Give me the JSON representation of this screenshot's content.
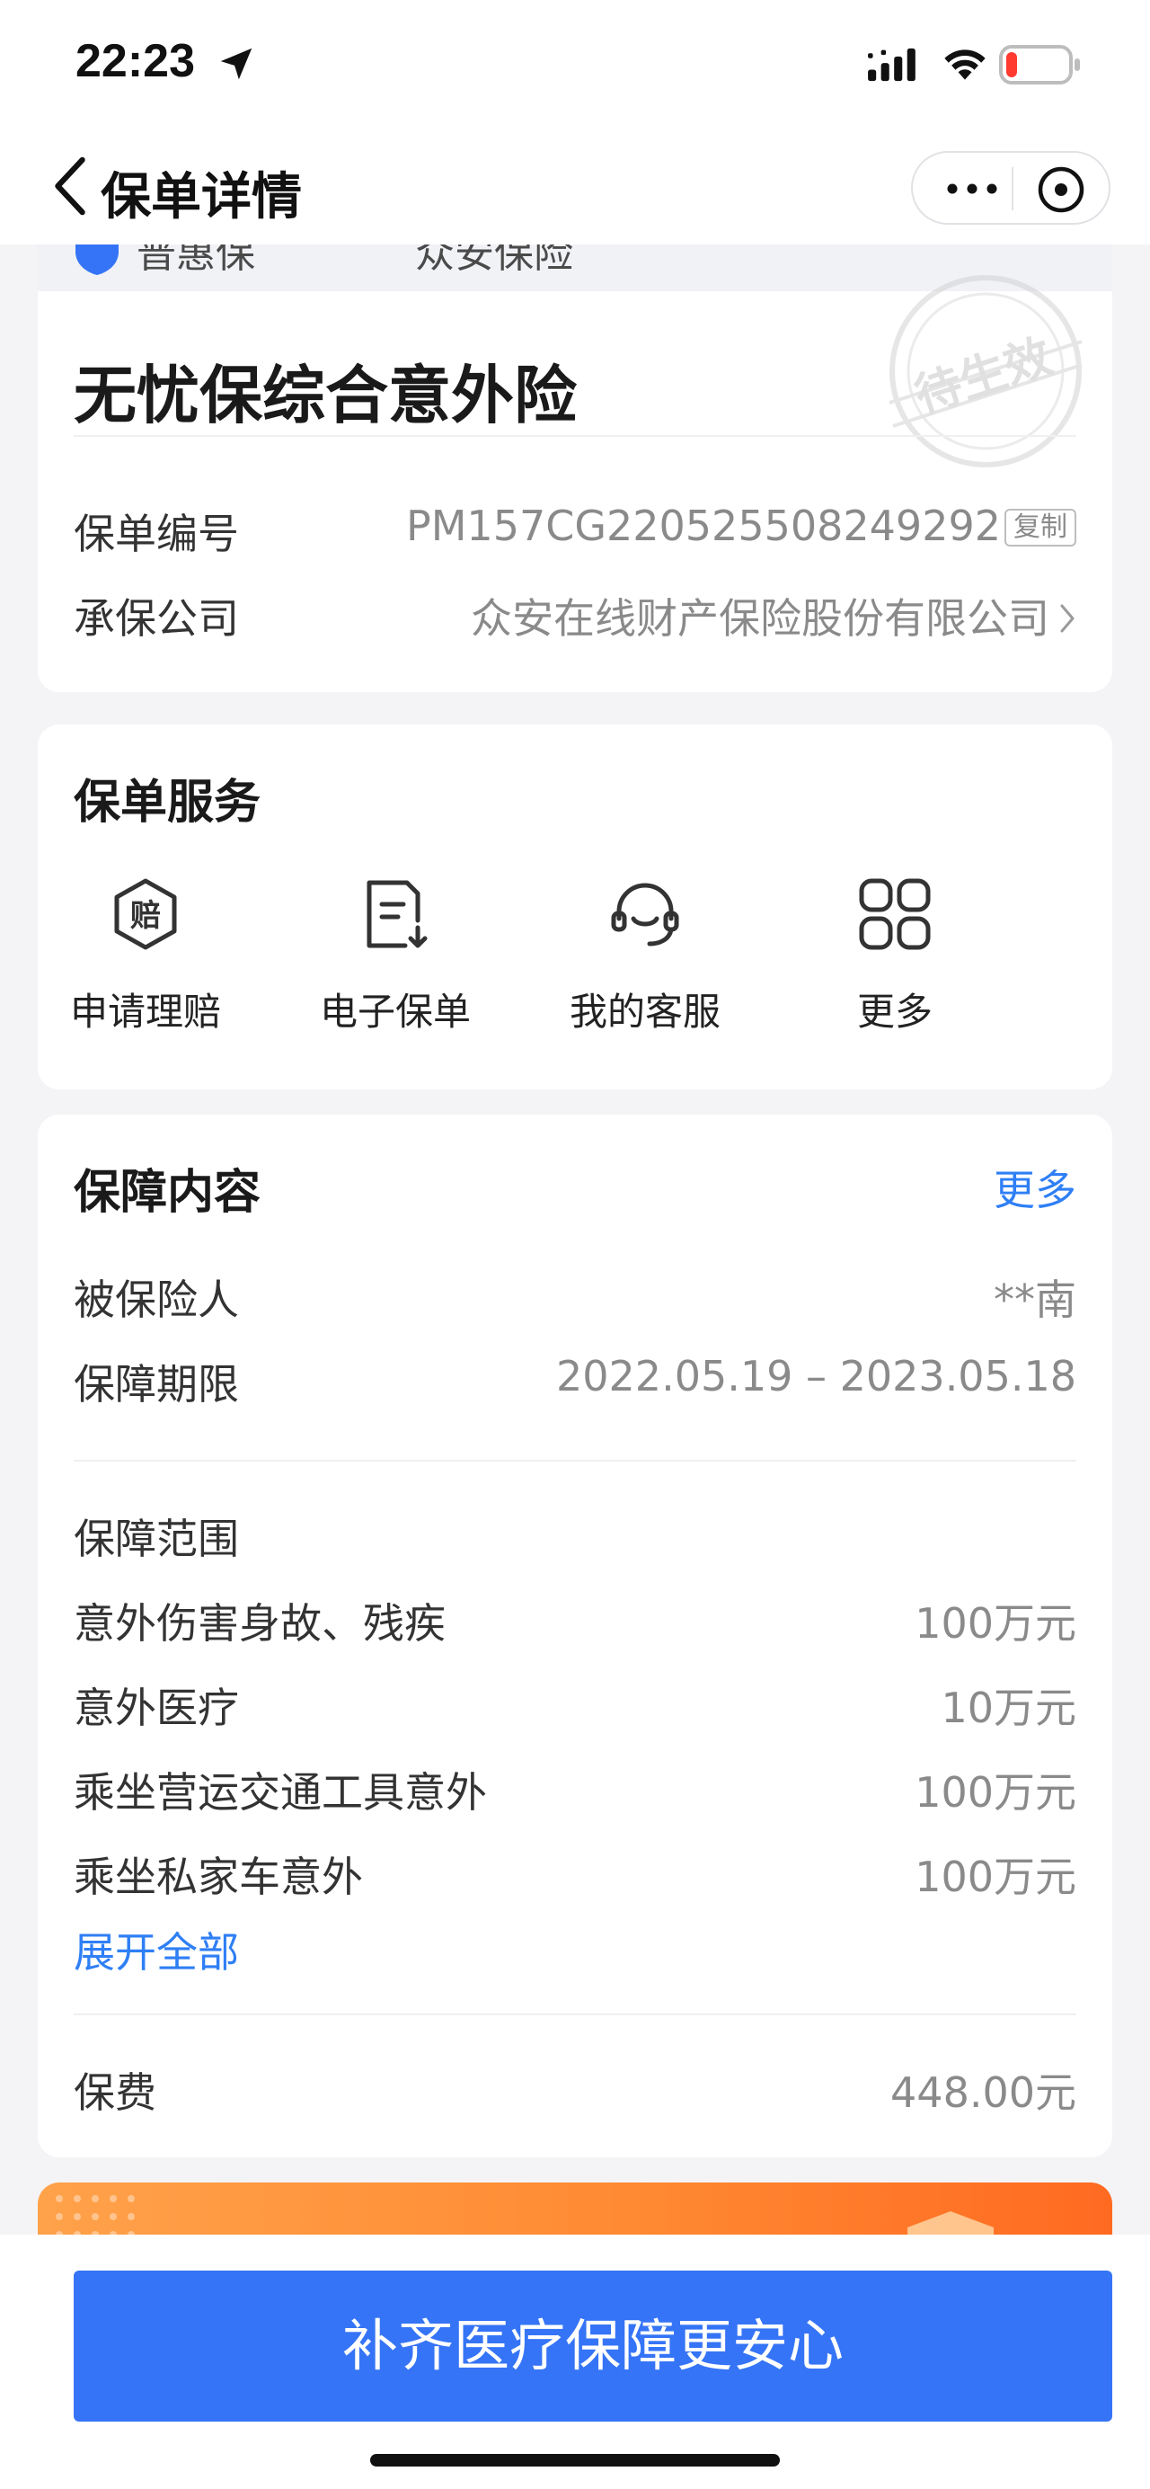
{
  "status_bar": {
    "time": "22:23",
    "icons": [
      "location-arrow-icon",
      "signal-icon",
      "wifi-icon",
      "battery-low-icon"
    ],
    "battery_color": "#ff3b30"
  },
  "nav": {
    "title": "保单详情",
    "icons": [
      "back-chevron-icon",
      "more-dots-icon",
      "close-circle-icon"
    ]
  },
  "cut_strip": {
    "left_text": "普惠保",
    "right_text": "众安保险"
  },
  "policy": {
    "name": "无忧保综合意外险",
    "stamp_text": "待生效",
    "number_label": "保单编号",
    "number_value": "PM157CG220525508249292",
    "copy_label": "复制",
    "insurer_label": "承保公司",
    "insurer_value": "众安在线财产保险股份有限公司"
  },
  "services": {
    "title": "保单服务",
    "items": [
      {
        "label": "申请理赔",
        "icon": "claim-hexagon-icon"
      },
      {
        "label": "电子保单",
        "icon": "e-policy-document-icon"
      },
      {
        "label": "我的客服",
        "icon": "customer-service-headset-icon"
      },
      {
        "label": "更多",
        "icon": "grid-four-icon"
      }
    ]
  },
  "coverage": {
    "title": "保障内容",
    "more_label": "更多",
    "insured_label": "被保险人",
    "insured_value": "**南",
    "period_label": "保障期限",
    "period_value": "2022.05.19 – 2023.05.18",
    "scope_title": "保障范围",
    "items": [
      {
        "label": "意外伤害身故、残疾",
        "value": "100万元"
      },
      {
        "label": "意外医疗",
        "value": "10万元"
      },
      {
        "label": "乘坐营运交通工具意外",
        "value": "100万元"
      },
      {
        "label": "乘坐私家车意外",
        "value": "100万元"
      }
    ],
    "expand_label": "展开全部",
    "premium_label": "保费",
    "premium_value": "448.00元"
  },
  "cta": {
    "label": "补齐医疗保障更安心",
    "color": "#3574f6"
  },
  "colors": {
    "link_blue": "#2f7ff5",
    "promo_orange": "#ff8a33"
  }
}
